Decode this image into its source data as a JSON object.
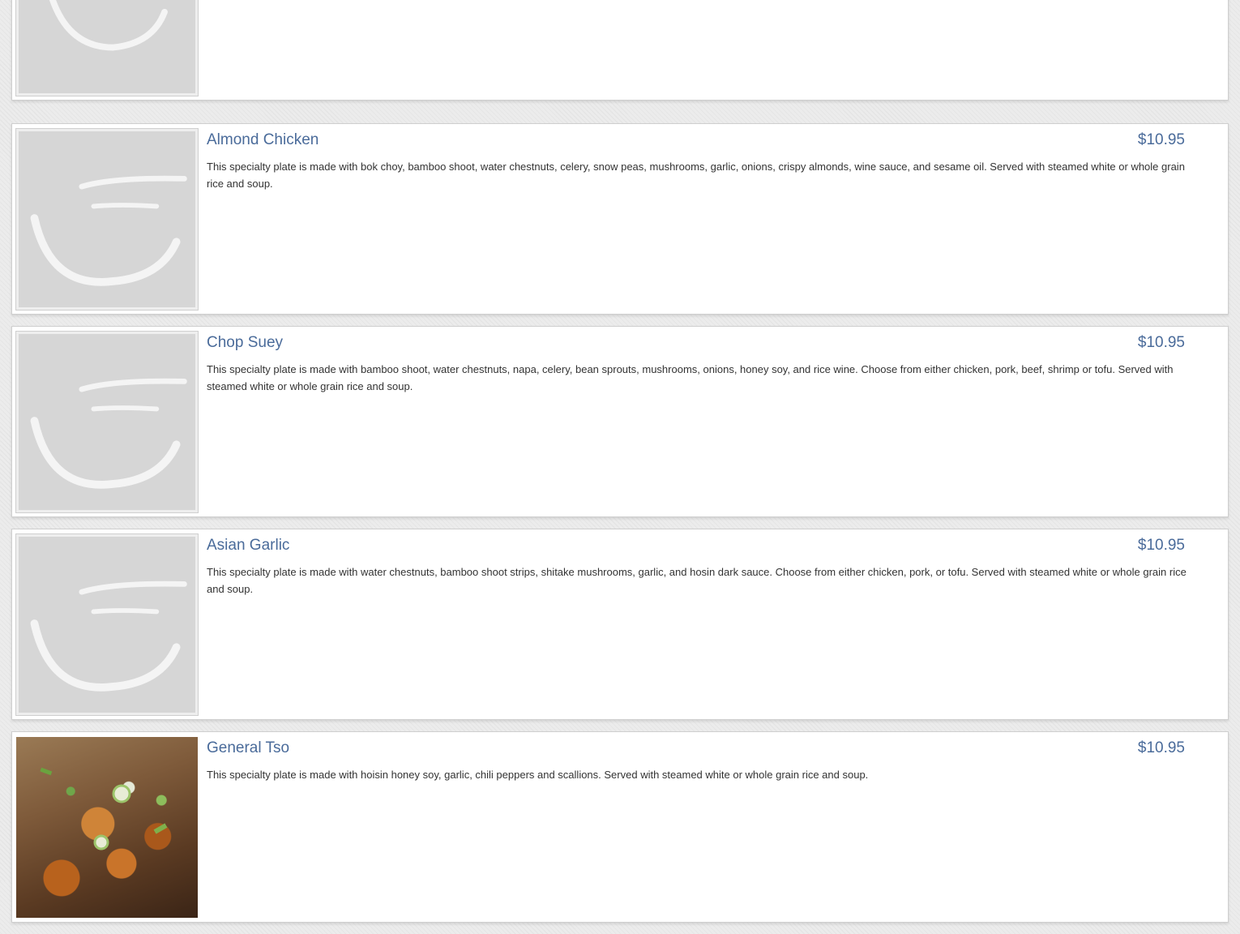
{
  "items": [
    {
      "name": "",
      "price": "",
      "description": "",
      "image": "placeholder-logo"
    },
    {
      "name": "Almond Chicken",
      "price": "$10.95",
      "description": "This specialty plate is made with bok choy, bamboo shoot, water chestnuts, celery, snow peas, mushrooms, garlic, onions, crispy almonds, wine sauce, and sesame oil. Served with steamed white or whole grain rice and soup.",
      "image": "placeholder-logo"
    },
    {
      "name": "Chop Suey",
      "price": "$10.95",
      "description": "This specialty plate is made with bamboo shoot, water chestnuts, napa, celery, bean sprouts, mushrooms, onions, honey soy, and rice wine. Choose from either chicken, pork, beef, shrimp or tofu. Served with steamed white or whole grain rice and soup.",
      "image": "placeholder-logo"
    },
    {
      "name": "Asian Garlic",
      "price": "$10.95",
      "description": "This specialty plate is made with water chestnuts, bamboo shoot strips, shitake mushrooms, garlic, and hosin dark sauce. Choose from either chicken, pork, or tofu. Served with steamed white or whole grain rice and soup.",
      "image": "placeholder-logo"
    },
    {
      "name": "General Tso",
      "price": "$10.95",
      "description": "This specialty plate is made with hoisin honey soy, garlic, chili peppers and scallions. Served with steamed white or whole grain rice and soup.",
      "image": "food-photo"
    }
  ],
  "colors": {
    "title": "#4a6b9a",
    "text": "#333333",
    "placeholder": "#d6d6d6"
  }
}
